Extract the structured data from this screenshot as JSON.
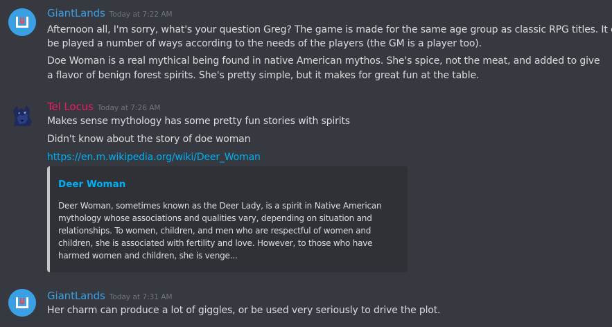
{
  "colors": {
    "background": "#36393f",
    "giantlands_name": "#3ba0e3",
    "tellocus_name": "#e91e63",
    "text": "#dcddde",
    "timestamp": "#72767d",
    "link": "#00b0f4",
    "embed_bg": "#2f3136",
    "embed_bar": "#c6c6c9"
  },
  "messages": [
    {
      "author": "GiantLands",
      "avatar_icon": "giantlands-logo-icon",
      "timestamp": "Today at 7:22 AM",
      "lines": [
        "Afternoon all, I'm sorry, what's your question Greg? The game is made for the same age group as classic RPG titles. It can",
        "be played a number of ways according to the needs of the players (the GM is a player too).",
        "Doe Woman is a real mythical being found in native American mythos. She's spice, not the meat, and added to give",
        "a flavor of benign forest spirits. She's pretty simple, but it makes for great fun at the table."
      ]
    },
    {
      "author": "Tel Locus",
      "avatar_icon": "wolf-avatar-icon",
      "timestamp": "Today at 7:26 AM",
      "lines": [
        "Makes sense mythology has some pretty fun stories with spirits",
        "Didn't know about the story of doe woman"
      ],
      "link": "https://en.m.wikipedia.org/wiki/Deer_Woman",
      "embed": {
        "title": "Deer Woman",
        "description_lines": [
          "Deer Woman, sometimes known as the Deer Lady, is a spirit in Native American",
          "mythology whose associations and qualities vary, depending on situation and",
          "relationships. To women, children, and men who are respectful of women and",
          "children, she is associated with fertility and love. However, to those who have",
          "harmed women and children, she is venge..."
        ]
      }
    },
    {
      "author": "GiantLands",
      "avatar_icon": "giantlands-logo-icon",
      "timestamp": "Today at 7:31 AM",
      "lines": [
        "Her charm can produce a lot of giggles, or be used very seriously to drive the plot."
      ]
    }
  ]
}
